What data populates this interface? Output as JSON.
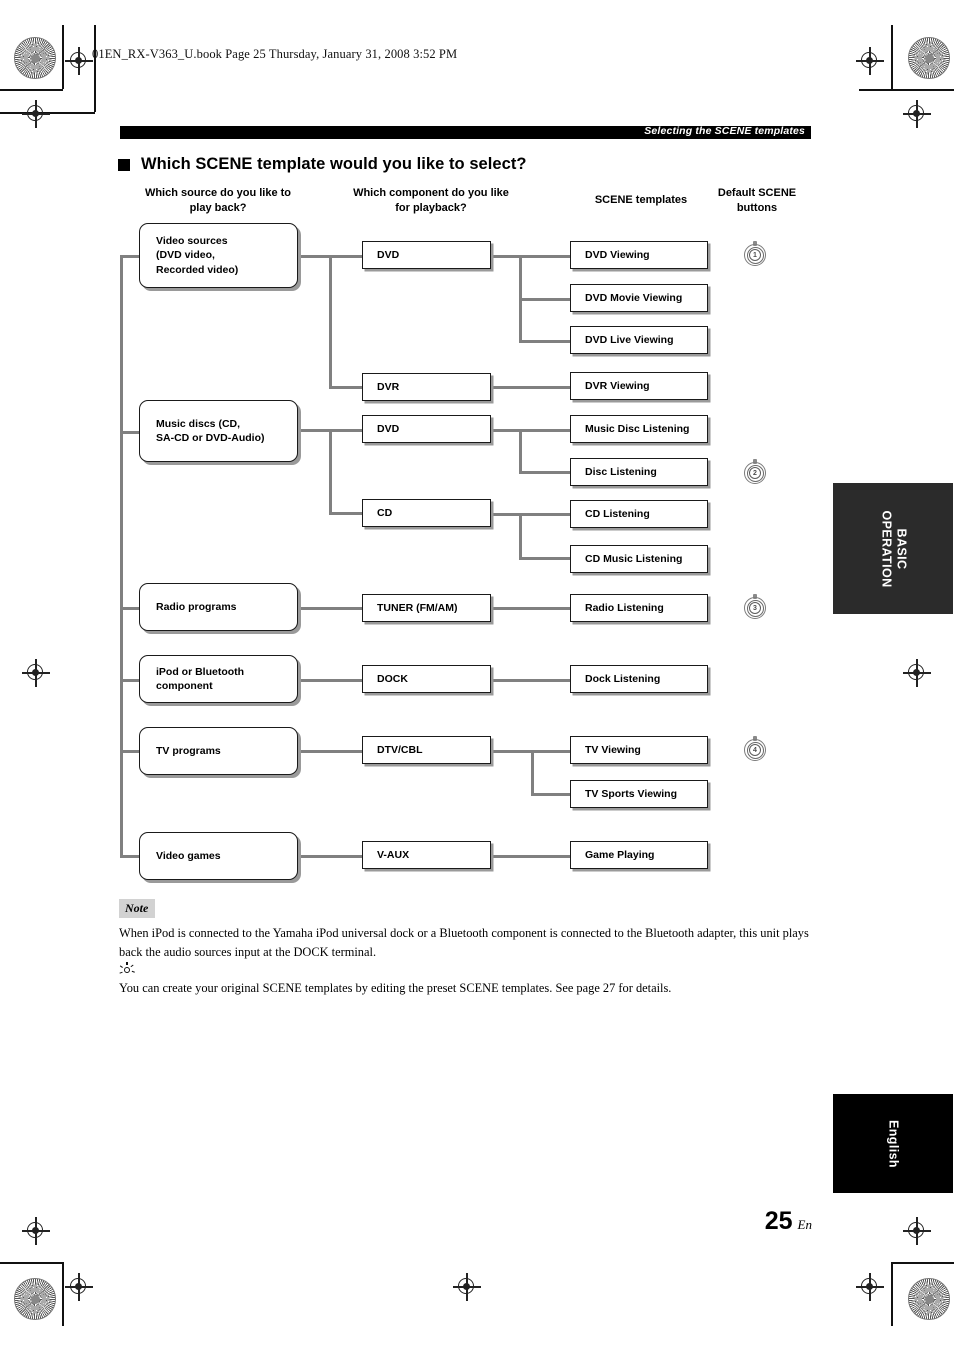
{
  "running_head": {
    "book_line": "01EN_RX-V363_U.book  Page 25  Thursday, January 31, 2008  3:52 PM",
    "chapter_bar": "Selecting the SCENE templates"
  },
  "section": {
    "title": "Which SCENE template would you like to select?"
  },
  "column_headers": {
    "source": "Which source do you like to play back?",
    "component": "Which component do you like for playback?",
    "templates": "SCENE templates",
    "buttons": "Default SCENE buttons"
  },
  "flow": {
    "sources": [
      {
        "label": "Video sources\n(DVD video,\nRecorded video)"
      },
      {
        "label": "Music discs (CD,\nSA-CD or DVD-Audio)"
      },
      {
        "label": "Radio programs"
      },
      {
        "label": "iPod or Bluetooth\ncomponent"
      },
      {
        "label": "TV programs"
      },
      {
        "label": "Video games"
      }
    ],
    "components": [
      {
        "label": "DVD"
      },
      {
        "label": "DVR"
      },
      {
        "label": "DVD"
      },
      {
        "label": "CD"
      },
      {
        "label": "TUNER (FM/AM)"
      },
      {
        "label": "DOCK"
      },
      {
        "label": "DTV/CBL"
      },
      {
        "label": "V-AUX"
      }
    ],
    "templates": [
      {
        "label": "DVD Viewing"
      },
      {
        "label": "DVD Movie Viewing"
      },
      {
        "label": "DVD Live Viewing"
      },
      {
        "label": "DVR Viewing"
      },
      {
        "label": "Music Disc Listening"
      },
      {
        "label": "Disc Listening"
      },
      {
        "label": "CD Listening"
      },
      {
        "label": "CD Music Listening"
      },
      {
        "label": "Radio Listening"
      },
      {
        "label": "Dock Listening"
      },
      {
        "label": "TV Viewing"
      },
      {
        "label": "TV Sports Viewing"
      },
      {
        "label": "Game Playing"
      }
    ],
    "scene_buttons": [
      {
        "number": "1"
      },
      {
        "number": "2"
      },
      {
        "number": "3"
      },
      {
        "number": "4"
      }
    ]
  },
  "note": {
    "tag": "Note",
    "body": "When iPod is connected to the Yamaha iPod universal dock or a Bluetooth component is connected to the Bluetooth adapter, this unit plays back the audio sources input at the DOCK terminal.",
    "tip": "You can create your original SCENE templates by editing the preset SCENE templates. See page 27 for details."
  },
  "side_tabs": {
    "basic_operation": "BASIC\nOPERATION",
    "english": "English"
  },
  "folio": {
    "page_number": "25",
    "suffix": "En"
  },
  "colors": {
    "bar": "#000000",
    "connector": "#808080",
    "tab": "#2b2b2b",
    "note_tag_bg": "#d2d2d2"
  }
}
